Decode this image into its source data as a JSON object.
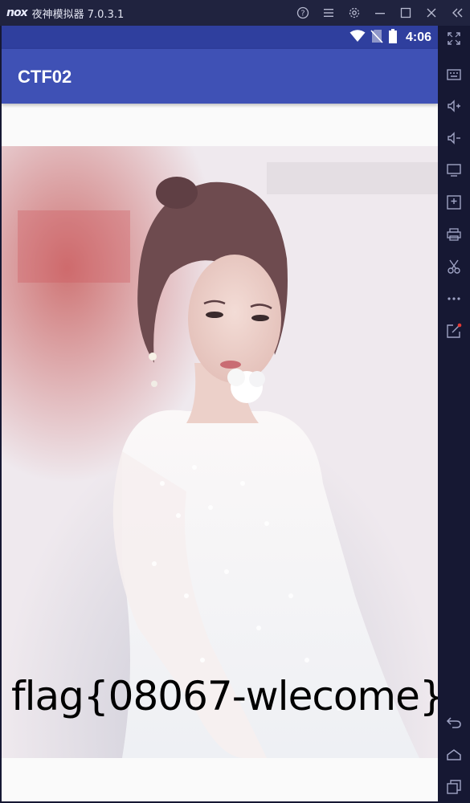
{
  "titlebar": {
    "logo_text": "nox",
    "app_title": "夜神模拟器 7.0.3.1",
    "controls": [
      "help-icon",
      "menu-icon",
      "settings-icon",
      "minimize-icon",
      "maximize-icon",
      "close-icon",
      "collapse-sidebar-icon"
    ]
  },
  "statusbar": {
    "time": "4:06",
    "icons": [
      "wifi-icon",
      "no-sim-icon",
      "battery-icon"
    ]
  },
  "app": {
    "title": "CTF02",
    "flag_text": "flag{08067-wlecome}"
  },
  "sidebar": {
    "buttons": [
      "fullscreen-icon",
      "keyboard-icon",
      "volume-up-icon",
      "volume-down-icon",
      "screen-icon",
      "add-apk-icon",
      "print-icon",
      "scissors-icon",
      "more-icon",
      "share-icon",
      "back-icon",
      "home-icon",
      "recent-apps-icon"
    ]
  },
  "colors": {
    "appbar": "#3f51b5",
    "statusbar": "#2f3f9e",
    "emulator_frame": "#161833"
  }
}
